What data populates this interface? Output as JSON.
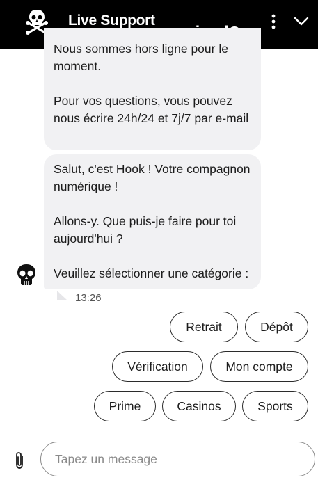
{
  "header": {
    "title": "Live Support",
    "brand": "casinodoc",
    "brand_prefix": "casinod",
    "brand_suffix": "c",
    "logo_icon": "skull-crossbones-icon",
    "menu_icon": "more-vertical-icon",
    "collapse_icon": "chevron-down-icon"
  },
  "messages": [
    {
      "from": "bot",
      "lines": [
        "Nous sommes hors ligne pour le moment.",
        "Pour vos questions, vous pouvez nous écrire 24h/24 et 7j/7 par e-mail"
      ]
    },
    {
      "from": "bot",
      "lines": [
        "Salut, c'est Hook ! Votre compagnon numérique !",
        "Allons-y. Que puis-je faire pour toi aujourd'hui ?",
        "Veuillez sélectionner une catégorie :"
      ],
      "time": "13:26",
      "avatar_icon": "skull-avatar-icon"
    }
  ],
  "quick_replies": [
    "Retrait",
    "Dépôt",
    "Vérification",
    "Mon compte",
    "Prime",
    "Casinos",
    "Sports"
  ],
  "composer": {
    "placeholder": "Tapez un message",
    "value": "",
    "attach_icon": "paperclip-icon"
  },
  "colors": {
    "header_bg": "#000000",
    "bubble_bg": "#f1f1f3",
    "brand_accent": "#ffffff"
  }
}
